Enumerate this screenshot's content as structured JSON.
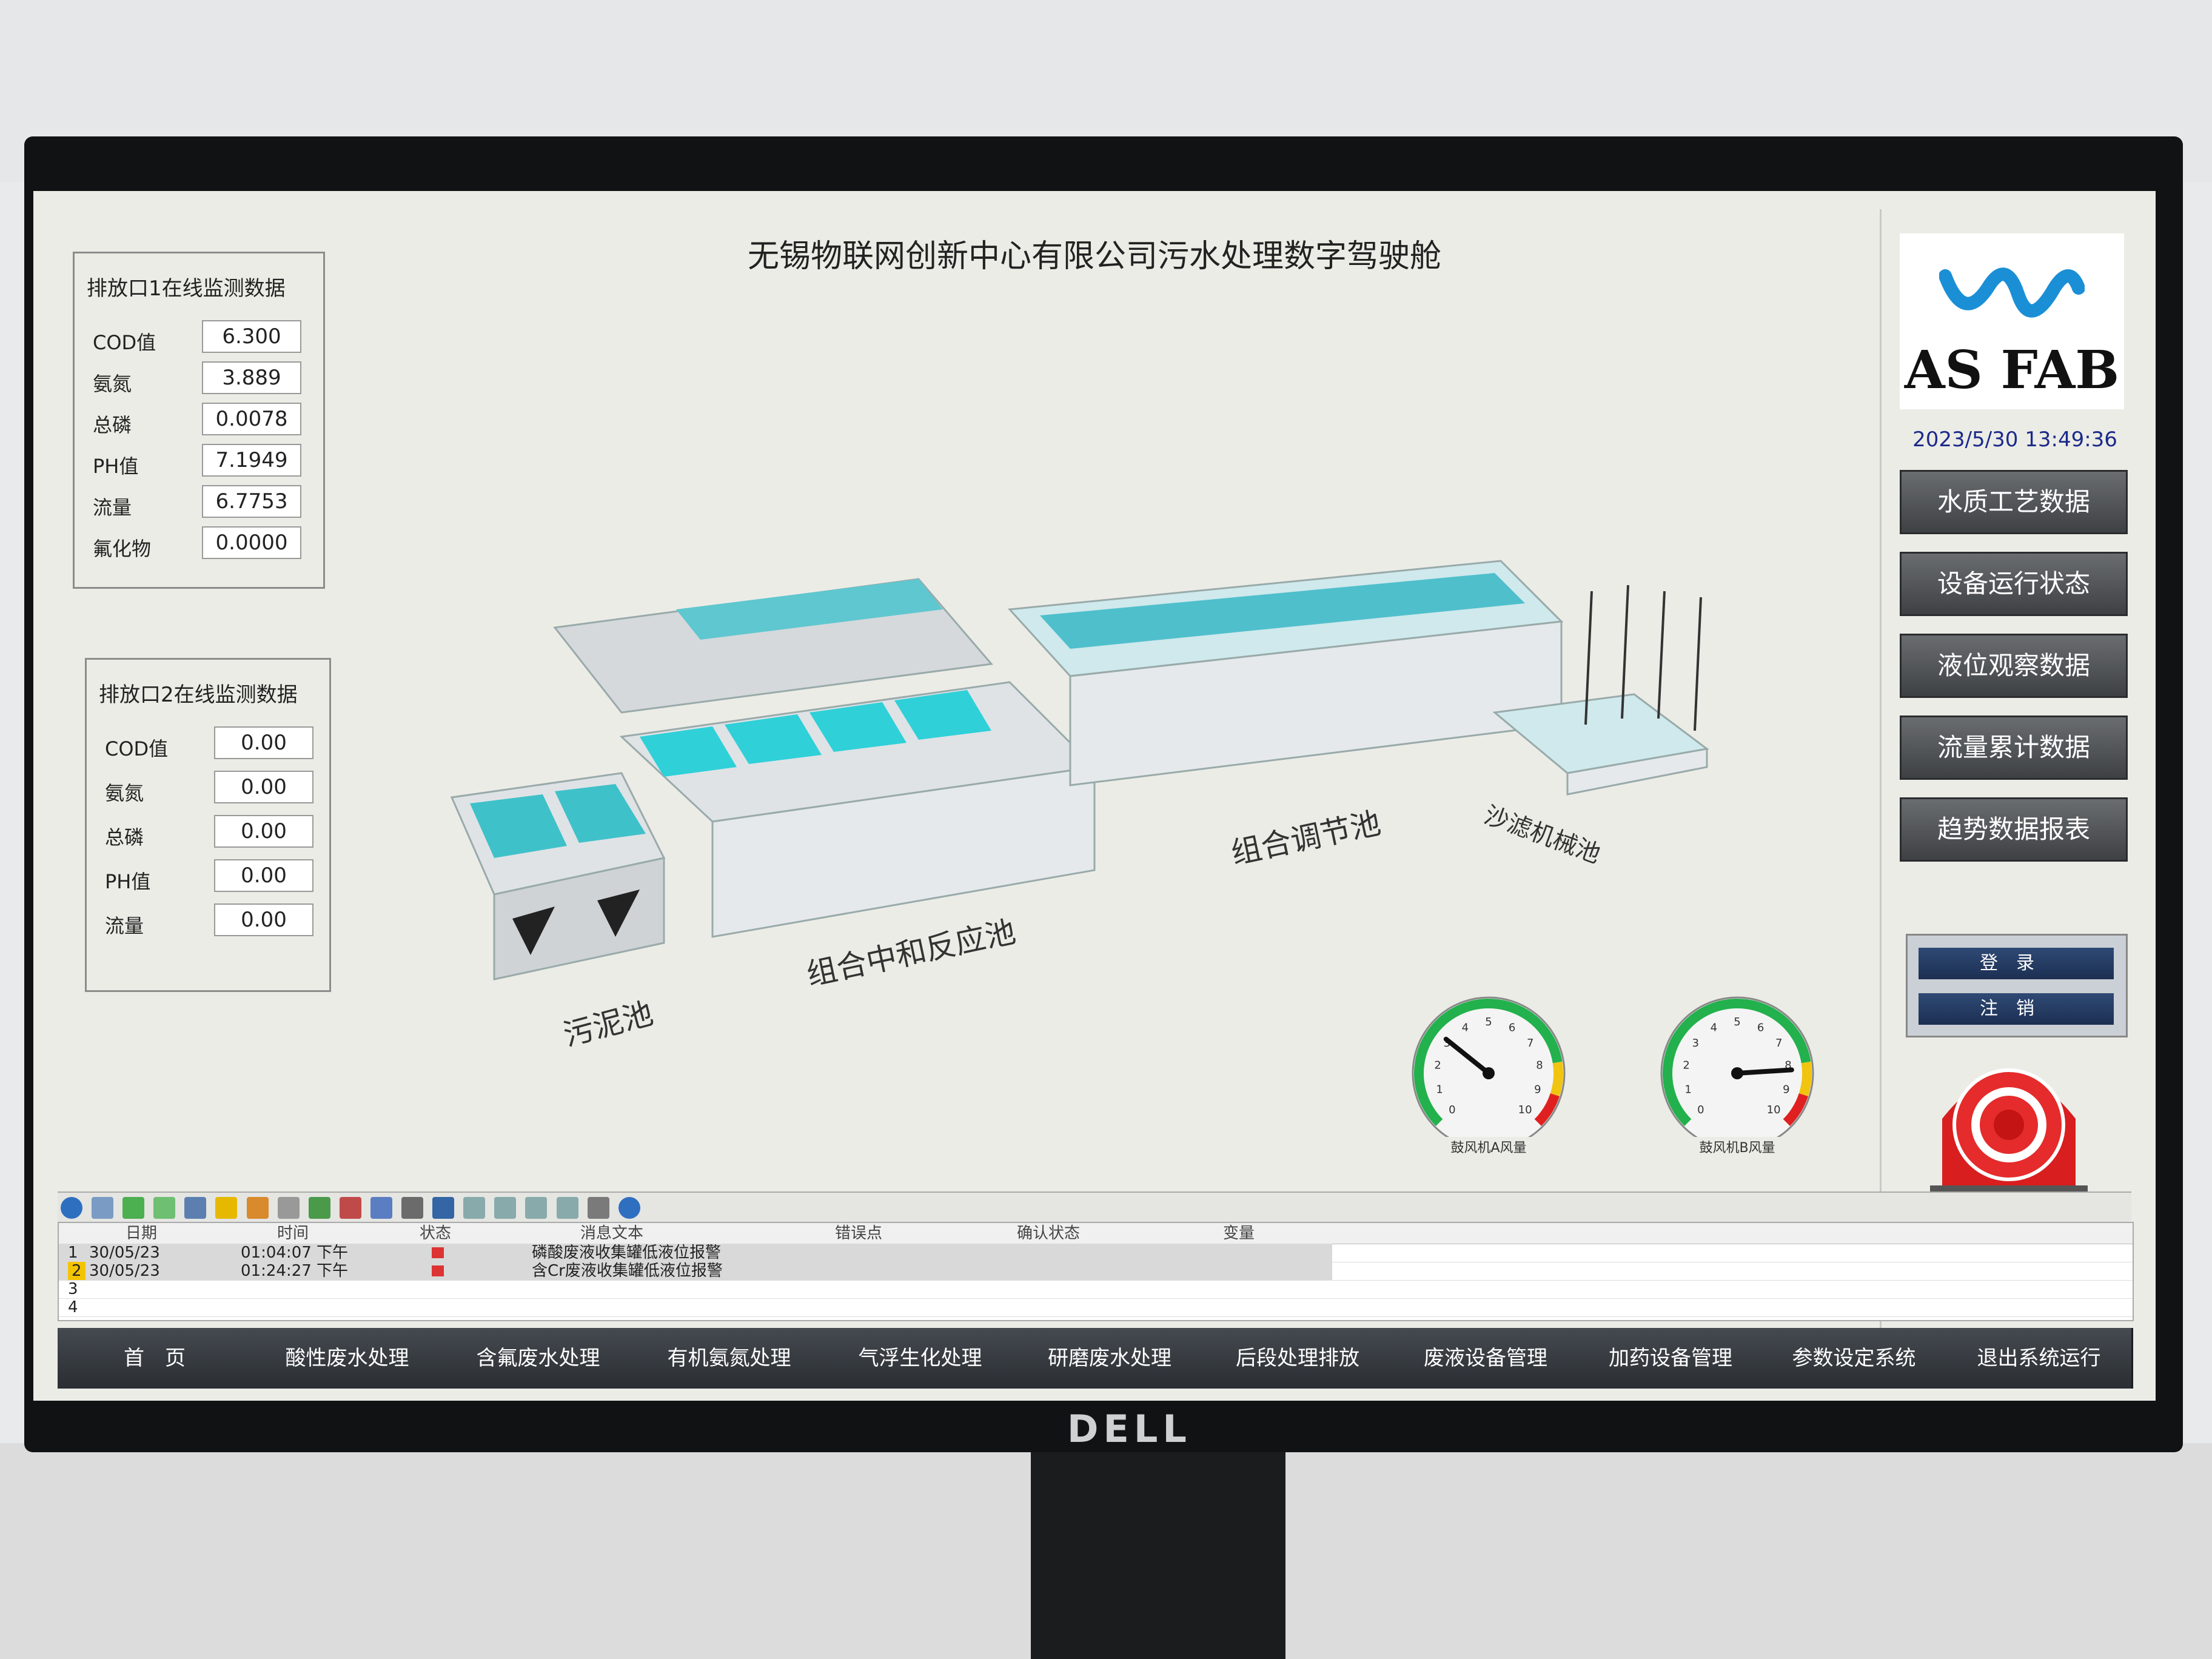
{
  "header": {
    "title": "无锡物联网创新中心有限公司污水处理数字驾驶舱"
  },
  "outlet1": {
    "title": "排放口1在线监测数据",
    "rows": [
      {
        "label": "COD值",
        "value": "6.300"
      },
      {
        "label": "氨氮",
        "value": "3.889"
      },
      {
        "label": "总磷",
        "value": "0.0078"
      },
      {
        "label": "PH值",
        "value": "7.1949"
      },
      {
        "label": "流量",
        "value": "6.7753"
      },
      {
        "label": "氟化物",
        "value": "0.0000"
      }
    ]
  },
  "outlet2": {
    "title": "排放口2在线监测数据",
    "rows": [
      {
        "label": "COD值",
        "value": "0.00"
      },
      {
        "label": "氨氮",
        "value": "0.00"
      },
      {
        "label": "总磷",
        "value": "0.00"
      },
      {
        "label": "PH值",
        "value": "0.00"
      },
      {
        "label": "流量",
        "value": "0.00"
      }
    ]
  },
  "scene": {
    "labels": [
      "污泥池",
      "组合中和反应池",
      "组合调节池",
      "沙滤机械池"
    ]
  },
  "sidebar": {
    "logo_text": "AS FAB",
    "datetime": "2023/5/30 13:49:36",
    "buttons": [
      "水质工艺数据",
      "设备运行状态",
      "液位观察数据",
      "流量累计数据",
      "趋势数据报表"
    ],
    "login": "登录",
    "logout": "注销"
  },
  "gauges": [
    {
      "label": "鼓风机A风量",
      "value": 3.1,
      "max": 10,
      "ticks": [
        "0",
        "1",
        "2",
        "3",
        "4",
        "5",
        "6",
        "7",
        "8",
        "9",
        "10"
      ]
    },
    {
      "label": "鼓风机B风量",
      "value": 8.2,
      "max": 10,
      "ticks": [
        "0",
        "1",
        "2",
        "3",
        "4",
        "5",
        "6",
        "7",
        "8",
        "9",
        "10"
      ]
    }
  ],
  "alarms": {
    "columns": [
      "日期",
      "时间",
      "状态",
      "消息文本",
      "错误点",
      "确认状态",
      "变量"
    ],
    "rows": [
      {
        "no": "1",
        "date": "30/05/23",
        "time": "01:04:07 下午",
        "text": "磷酸废液收集罐低液位报警"
      },
      {
        "no": "2",
        "date": "30/05/23",
        "time": "01:24:27 下午",
        "text": "含Cr废液收集罐低液位报警"
      },
      {
        "no": "3"
      },
      {
        "no": "4"
      }
    ]
  },
  "bottom_nav": [
    "首　页",
    "酸性废水处理",
    "含氟废水处理",
    "有机氨氮处理",
    "气浮生化处理",
    "研磨废水处理",
    "后段处理排放",
    "废液设备管理",
    "加药设备管理",
    "参数设定系统",
    "退出系统运行"
  ],
  "monitor": {
    "brand": "DELL"
  },
  "colors": {
    "pool": "#3fc1c9",
    "nav": "#3e4144",
    "gauge_green": "#22b14c",
    "gauge_red": "#e02020"
  }
}
